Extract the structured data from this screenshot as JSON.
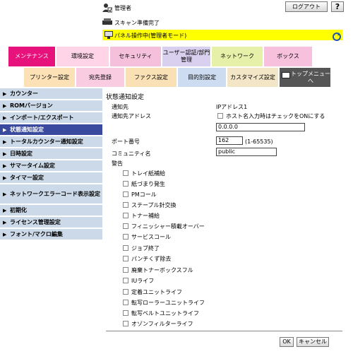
{
  "header": {
    "user_name": "管理者",
    "logout_label": "ログアウト",
    "help_label": "?",
    "scan_status": "スキャン準備完了",
    "panel_status": "パネル操作中(管理者モード)",
    "colors": {
      "panel_bar": "#ffff00"
    }
  },
  "main_tabs": [
    {
      "label": "メンテナンス",
      "color": "#e8127c",
      "active": true
    },
    {
      "label": "環境設定",
      "color": "#ffd4e6"
    },
    {
      "label": "セキュリティ",
      "color": "#f5c0dc"
    },
    {
      "label": "ユーザー認証/部門管理",
      "color": "#d9d0ef"
    },
    {
      "label": "ネットワーク",
      "color": "#e6f0a8"
    },
    {
      "label": "ボックス",
      "color": "#f7c0dd"
    }
  ],
  "sub_tabs": [
    {
      "label": "プリンター設定",
      "color": "#fbe1b5"
    },
    {
      "label": "宛先登録",
      "color": "#f9cce2"
    },
    {
      "label": "ファクス設定",
      "color": "#fae0b5"
    },
    {
      "label": "目的別設定",
      "color": "#cddcf0"
    },
    {
      "label": "カスタマイズ設定",
      "color": "#f3e6c6"
    },
    {
      "label": "トップメニューへ",
      "color": "#555555"
    }
  ],
  "sidebar": {
    "items": [
      {
        "label": "カウンター"
      },
      {
        "label": "ROMバージョン"
      },
      {
        "label": "インポート/エクスポート"
      },
      {
        "label": "状態通知設定",
        "active": true
      },
      {
        "label": "トータルカウンター通知設定"
      },
      {
        "label": "日時設定"
      },
      {
        "label": "サマータイム設定"
      },
      {
        "label": "タイマー設定"
      },
      {
        "label": "ネットワークエラーコード表示設定"
      },
      {
        "label": "初期化"
      },
      {
        "label": "ライセンス管理設定"
      },
      {
        "label": "フォント/マクロ編集"
      }
    ]
  },
  "content": {
    "title": "状態通知設定",
    "dest_label": "通知先",
    "dest_value": "IPアドレス1",
    "address_label": "通知先アドレス",
    "host_checkbox_label": "ホスト名入力時はチェックをONにする",
    "address_value": "0.0.0.0",
    "port_label": "ポート番号",
    "port_value": "162",
    "port_range": "(1-65535)",
    "community_label": "コミュニティ名",
    "community_value": "public",
    "alert_label": "警告",
    "alerts": [
      "トレイ紙補給",
      "紙づまり発生",
      "PMコール",
      "ステープル針交換",
      "トナー補給",
      "フィニッシャー積載オーバー",
      "サービスコール",
      "ジョブ終了",
      "パンチくず除去",
      "廃棄トナーボックスフル",
      "IUライフ",
      "定着ユニットライフ",
      "転写ローラーユニットライフ",
      "転写ベルトユニットライフ",
      "オゾンフィルターライフ"
    ],
    "ok_label": "OK",
    "cancel_label": "キャンセル"
  }
}
